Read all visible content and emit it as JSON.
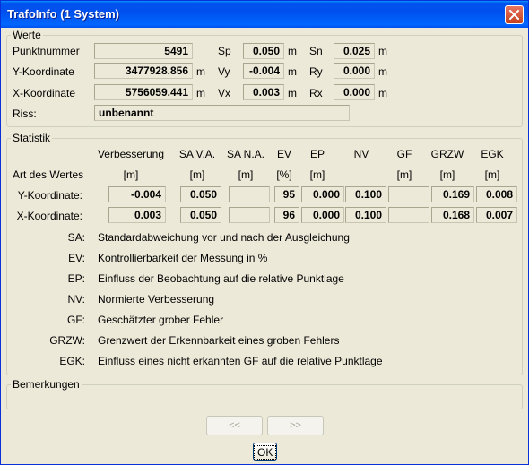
{
  "window": {
    "title": "TrafoInfo (1 System)"
  },
  "werte": {
    "legend": "Werte",
    "punktnummer_label": "Punktnummer",
    "punktnummer": "5491",
    "y_label": "Y-Koordinate",
    "y_value": "3477928.856",
    "x_label": "X-Koordinate",
    "x_value": "5756059.441",
    "riss_label": "Riss:",
    "riss_value": "unbenannt",
    "unit_m": "m",
    "sp_label": "Sp",
    "sp_value": "0.050",
    "vy_label": "Vy",
    "vy_value": "-0.004",
    "vx_label": "Vx",
    "vx_value": "0.003",
    "sn_label": "Sn",
    "sn_value": "0.025",
    "ry_label": "Ry",
    "ry_value": "0.000",
    "rx_label": "Rx",
    "rx_value": "0.000"
  },
  "statistik": {
    "legend": "Statistik",
    "headers": [
      "Verbesserung",
      "SA V.A.",
      "SA N.A.",
      "EV",
      "EP",
      "NV",
      "GF",
      "GRZW",
      "EGK"
    ],
    "art_label": "Art des Wertes",
    "units": [
      "[m]",
      "[m]",
      "[m]",
      "[%]",
      "[m]",
      "",
      "[m]",
      "[m]",
      "[m]"
    ],
    "rows": [
      {
        "label": "Y-Koordinate:",
        "values": [
          "-0.004",
          "0.050",
          "",
          "95",
          "0.000",
          "0.100",
          "",
          "0.169",
          "0.008"
        ]
      },
      {
        "label": "X-Koordinate:",
        "values": [
          "0.003",
          "0.050",
          "",
          "96",
          "0.000",
          "0.100",
          "",
          "0.168",
          "0.007"
        ]
      }
    ],
    "legend_items": [
      {
        "abbr": "SA:",
        "text": "Standardabweichung vor und nach der Ausgleichung"
      },
      {
        "abbr": "EV:",
        "text": "Kontrollierbarkeit der Messung in %"
      },
      {
        "abbr": "EP:",
        "text": "Einfluss der Beobachtung auf die relative Punktlage"
      },
      {
        "abbr": "NV:",
        "text": "Normierte Verbesserung"
      },
      {
        "abbr": "GF:",
        "text": "Geschätzter grober Fehler"
      },
      {
        "abbr": "GRZW:",
        "text": "Grenzwert der Erkennbarkeit eines groben Fehlers"
      },
      {
        "abbr": "EGK:",
        "text": "Einfluss eines nicht erkannten GF auf die relative Punktlage"
      }
    ]
  },
  "bemerkungen": {
    "legend": "Bemerkungen"
  },
  "buttons": {
    "prev": "<<",
    "next": ">>",
    "ok": "OK"
  },
  "icons": {
    "close": "close-icon"
  },
  "colors": {
    "titlebar": "#0054e3",
    "window_bg": "#ece9d8",
    "close_button": "#d6452a"
  }
}
